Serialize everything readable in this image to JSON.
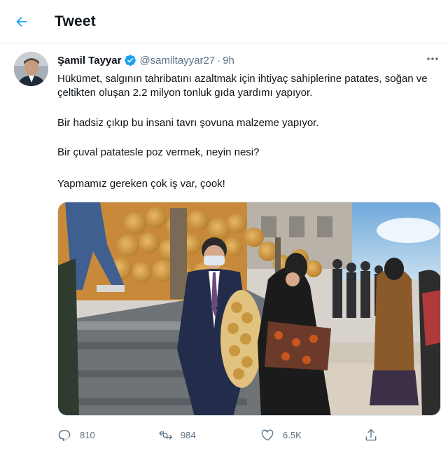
{
  "header": {
    "title": "Tweet"
  },
  "tweet": {
    "author": {
      "display_name": "Şamil Tayyar",
      "handle": "@samiltayyar27",
      "verified": true
    },
    "separator": "·",
    "time": "9h",
    "paragraphs": [
      "Hükümet, salgının tahribatını azaltmak için ihtiyaç sahiplerine patates, soğan ve çeltikten oluşan 2.2 milyon tonluk gıda yardımı yapıyor.",
      "Bir hadsiz çıkıp bu insani tavrı şovuna malzeme yapıyor.",
      "Bir çuval patatesle poz vermek, neyin nesi?",
      "Yapmamız gereken çok iş var, çook!"
    ],
    "stats": {
      "replies": "810",
      "retweets": "984",
      "likes": "6.5K"
    }
  },
  "colors": {
    "accent": "#1da1f2",
    "secondary_text": "#5b7083",
    "primary_text": "#0f1419",
    "border": "#e6ecf0"
  },
  "icons": {
    "back": "arrow-left-icon",
    "verified": "verified-badge-icon",
    "more": "more-horizontal-icon",
    "reply": "reply-icon",
    "retweet": "retweet-icon",
    "like": "heart-icon",
    "share": "share-icon"
  }
}
